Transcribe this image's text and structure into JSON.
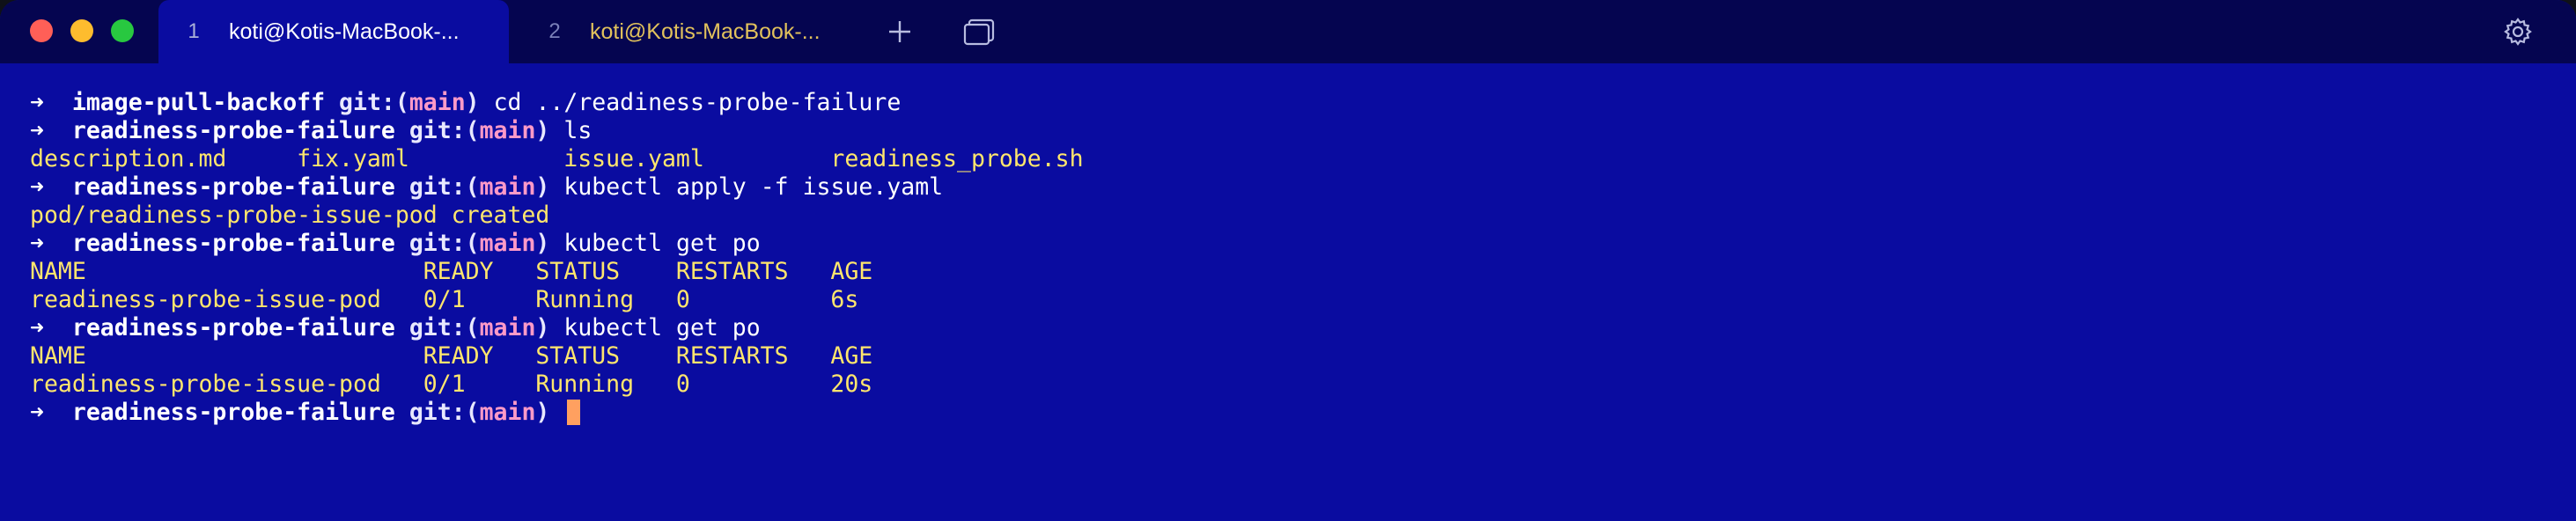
{
  "tabs": [
    {
      "number": "1",
      "title": "koti@Kotis-MacBook-...",
      "active": true
    },
    {
      "number": "2",
      "title": "koti@Kotis-MacBook-...",
      "active": false
    }
  ],
  "toolbar": {
    "new_tab_icon": "plus-icon",
    "tab_overview_icon": "tab-overview-icon",
    "settings_icon": "gear-icon"
  },
  "colors": {
    "terminal_bg": "#0a0ca0",
    "titlebar_bg": "#050550",
    "output_yellow": "#ffe66d",
    "branch_pink": "#ff9ac8",
    "cursor": "#ffa060"
  },
  "prompt": {
    "arrow": "➜",
    "git_label": "git:(",
    "branch": "main",
    "git_close": ")"
  },
  "lines": [
    {
      "type": "prompt",
      "dir": "image-pull-backoff",
      "cmd": "cd ../readiness-probe-failure"
    },
    {
      "type": "prompt",
      "dir": "readiness-probe-failure",
      "cmd": "ls"
    },
    {
      "type": "output",
      "style": "out",
      "text": "description.md     fix.yaml           issue.yaml         readiness_probe.sh"
    },
    {
      "type": "prompt",
      "dir": "readiness-probe-failure",
      "cmd": "kubectl apply -f issue.yaml"
    },
    {
      "type": "output",
      "style": "out",
      "text": "pod/readiness-probe-issue-pod created"
    },
    {
      "type": "prompt",
      "dir": "readiness-probe-failure",
      "cmd": "kubectl get po"
    },
    {
      "type": "output",
      "style": "out",
      "text": "NAME                        READY   STATUS    RESTARTS   AGE"
    },
    {
      "type": "output",
      "style": "out",
      "text": "readiness-probe-issue-pod   0/1     Running   0          6s"
    },
    {
      "type": "prompt",
      "dir": "readiness-probe-failure",
      "cmd": "kubectl get po"
    },
    {
      "type": "output",
      "style": "out",
      "text": "NAME                        READY   STATUS    RESTARTS   AGE"
    },
    {
      "type": "output",
      "style": "out",
      "text": "readiness-probe-issue-pod   0/1     Running   0          20s"
    },
    {
      "type": "prompt",
      "dir": "readiness-probe-failure",
      "cmd": "",
      "cursor": true
    }
  ]
}
